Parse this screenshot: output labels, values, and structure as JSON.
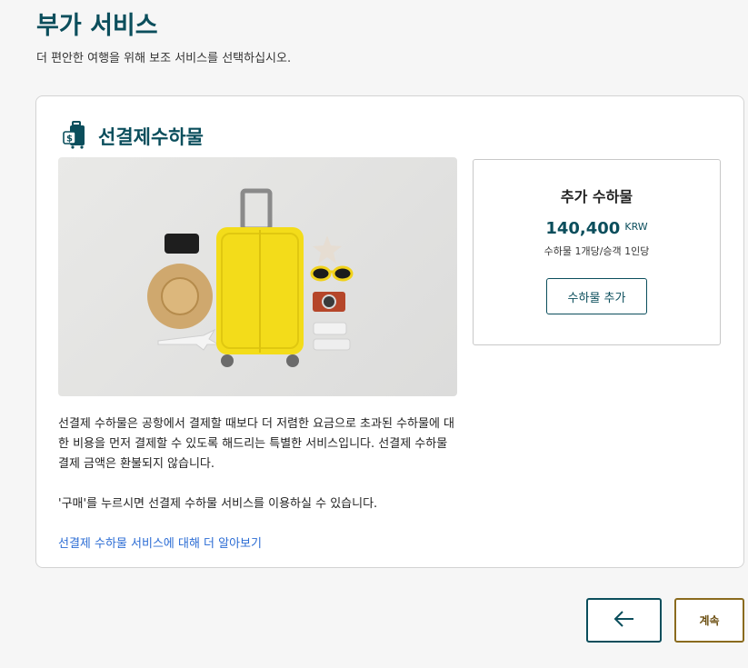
{
  "page": {
    "title": "부가 서비스",
    "subtitle": "더 편안한 여행을 위해 보조 서비스를 선택하십시오."
  },
  "service": {
    "title": "선결제수하물",
    "icon": "luggage-payment-icon",
    "description": [
      "선결제 수하물은 공항에서 결제할 때보다 더 저렴한 요금으로 초과된 수하물에 대한 비용을 먼저 결제할 수 있도록 해드리는 특별한 서비스입니다. 선결제 수하물 결제 금액은 환불되지 않습니다.",
      "'구매'를 누르시면 선결제 수하물 서비스를 이용하실 수 있습니다."
    ],
    "learn_more": "선결제 수하물 서비스에 대해 더 알아보기"
  },
  "offer": {
    "title": "추가 수하물",
    "price": "140,400",
    "currency": "KRW",
    "note": "수하물 1개당/승객 1인당",
    "button": "수하물 추가"
  },
  "nav": {
    "back_icon": "arrow-left-icon",
    "next_label": "계속"
  },
  "colors": {
    "brand": "#0b4e5c",
    "link": "#2b6cd4",
    "next_border": "#8a6b1e"
  }
}
